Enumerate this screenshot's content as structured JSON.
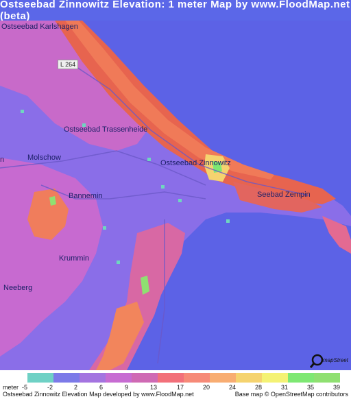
{
  "title": "Ostseebad Zinnowitz Elevation: 1 meter Map by www.FloodMap.net (beta)",
  "map": {
    "road_badge": "L 264",
    "places": [
      {
        "name": "Ostseebad Karlshagen",
        "key": "karlshagen"
      },
      {
        "name": "Ostseebad Trassenheide",
        "key": "trassenheide"
      },
      {
        "name": "Ostseebad Zinnowitz",
        "key": "zinnowitz"
      },
      {
        "name": "Molschow",
        "key": "molschow"
      },
      {
        "name": "Bannemin",
        "key": "bannemin"
      },
      {
        "name": "Seebad Zempin",
        "key": "zempin"
      },
      {
        "name": "Krummin",
        "key": "krummin"
      },
      {
        "name": "Neeberg",
        "key": "neeberg"
      },
      {
        "name": "n",
        "key": "edge-n"
      }
    ],
    "colors": {
      "water": "#5c62e6",
      "lowland": "#8e6fe6",
      "land_low": "#c66ac8",
      "land_mid": "#e0669a",
      "land_high": "#f36f5f",
      "green": "#6ae07a",
      "cyan": "#6fd6c0"
    }
  },
  "legend": {
    "unit_label": "meter",
    "ticks": [
      "-5",
      "-2",
      "2",
      "6",
      "9",
      "13",
      "17",
      "20",
      "24",
      "28",
      "31",
      "35",
      "39"
    ],
    "swatches": [
      "#6fd1c5",
      "#7c7ae8",
      "#a474e0",
      "#c76cd2",
      "#cf6ab4",
      "#f2707a",
      "#f68a78",
      "#f8ad72",
      "#f5d36f",
      "#f4f275",
      "#7ee873",
      "#8fe071"
    ]
  },
  "footer": {
    "left": "Ostseebad Zinnowitz Elevation Map developed by www.FloodMap.net",
    "right": "Base map © OpenStreetMap contributors"
  }
}
